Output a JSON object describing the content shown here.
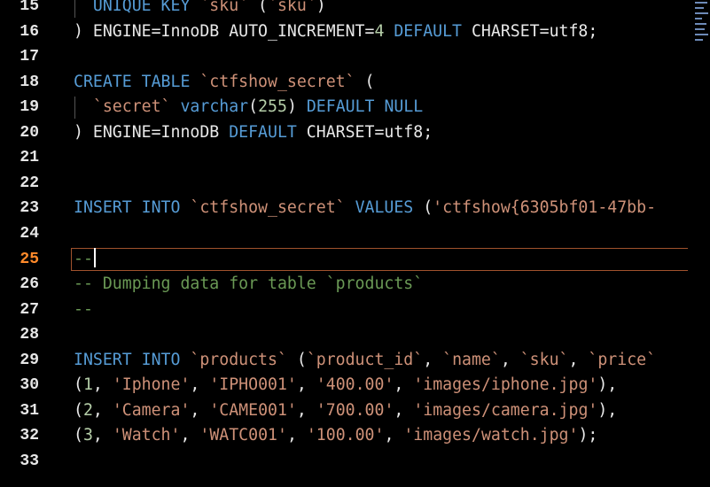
{
  "editor": {
    "active_line": 25,
    "lines": [
      {
        "n": "15",
        "tokens": [
          [
            "pl",
            "  "
          ],
          [
            "kw",
            "UNIQUE KEY"
          ],
          [
            "pl",
            " "
          ],
          [
            "str",
            "`sku`"
          ],
          [
            "pl",
            " ("
          ],
          [
            "str",
            "`sku`"
          ],
          [
            "pl",
            ")"
          ]
        ]
      },
      {
        "n": "16",
        "tokens": [
          [
            "pl",
            ") ENGINE=InnoDB AUTO_INCREMENT="
          ],
          [
            "num",
            "4"
          ],
          [
            "pl",
            " "
          ],
          [
            "kw",
            "DEFAULT"
          ],
          [
            "pl",
            " CHARSET=utf8;"
          ]
        ]
      },
      {
        "n": "17",
        "tokens": []
      },
      {
        "n": "18",
        "tokens": [
          [
            "kw",
            "CREATE TABLE"
          ],
          [
            "pl",
            " "
          ],
          [
            "str",
            "`ctfshow_secret`"
          ],
          [
            "pl",
            " ("
          ]
        ]
      },
      {
        "n": "19",
        "tokens": [
          [
            "pl",
            "  "
          ],
          [
            "str",
            "`secret`"
          ],
          [
            "pl",
            " "
          ],
          [
            "kw",
            "varchar"
          ],
          [
            "pl",
            "("
          ],
          [
            "num",
            "255"
          ],
          [
            "pl",
            ") "
          ],
          [
            "kw",
            "DEFAULT NULL"
          ]
        ]
      },
      {
        "n": "20",
        "tokens": [
          [
            "pl",
            ") ENGINE=InnoDB "
          ],
          [
            "kw",
            "DEFAULT"
          ],
          [
            "pl",
            " CHARSET=utf8;"
          ]
        ]
      },
      {
        "n": "21",
        "tokens": []
      },
      {
        "n": "22",
        "tokens": []
      },
      {
        "n": "23",
        "tokens": [
          [
            "kw",
            "INSERT INTO"
          ],
          [
            "pl",
            " "
          ],
          [
            "str",
            "`ctfshow_secret`"
          ],
          [
            "pl",
            " "
          ],
          [
            "kw",
            "VALUES"
          ],
          [
            "pl",
            " ("
          ],
          [
            "str",
            "'ctfshow{6305bf01-47bb-"
          ]
        ]
      },
      {
        "n": "24",
        "tokens": []
      },
      {
        "n": "25",
        "tokens": [
          [
            "cm",
            "--"
          ]
        ]
      },
      {
        "n": "26",
        "tokens": [
          [
            "cm",
            "-- Dumping data for table `products`"
          ]
        ]
      },
      {
        "n": "27",
        "tokens": [
          [
            "cm",
            "--"
          ]
        ]
      },
      {
        "n": "28",
        "tokens": []
      },
      {
        "n": "29",
        "tokens": [
          [
            "kw",
            "INSERT INTO"
          ],
          [
            "pl",
            " "
          ],
          [
            "str",
            "`products`"
          ],
          [
            "pl",
            " ("
          ],
          [
            "str",
            "`product_id`"
          ],
          [
            "pl",
            ", "
          ],
          [
            "str",
            "`name`"
          ],
          [
            "pl",
            ", "
          ],
          [
            "str",
            "`sku`"
          ],
          [
            "pl",
            ", "
          ],
          [
            "str",
            "`price`"
          ]
        ]
      },
      {
        "n": "30",
        "tokens": [
          [
            "pl",
            "("
          ],
          [
            "num",
            "1"
          ],
          [
            "pl",
            ", "
          ],
          [
            "str",
            "'Iphone'"
          ],
          [
            "pl",
            ", "
          ],
          [
            "str",
            "'IPHO001'"
          ],
          [
            "pl",
            ", "
          ],
          [
            "str",
            "'400.00'"
          ],
          [
            "pl",
            ", "
          ],
          [
            "str",
            "'images/iphone.jpg'"
          ],
          [
            "pl",
            "),"
          ]
        ]
      },
      {
        "n": "31",
        "tokens": [
          [
            "pl",
            "("
          ],
          [
            "num",
            "2"
          ],
          [
            "pl",
            ", "
          ],
          [
            "str",
            "'Camera'"
          ],
          [
            "pl",
            ", "
          ],
          [
            "str",
            "'CAME001'"
          ],
          [
            "pl",
            ", "
          ],
          [
            "str",
            "'700.00'"
          ],
          [
            "pl",
            ", "
          ],
          [
            "str",
            "'images/camera.jpg'"
          ],
          [
            "pl",
            "),"
          ]
        ]
      },
      {
        "n": "32",
        "tokens": [
          [
            "pl",
            "("
          ],
          [
            "num",
            "3"
          ],
          [
            "pl",
            ", "
          ],
          [
            "str",
            "'Watch'"
          ],
          [
            "pl",
            ", "
          ],
          [
            "str",
            "'WATC001'"
          ],
          [
            "pl",
            ", "
          ],
          [
            "str",
            "'100.00'"
          ],
          [
            "pl",
            ", "
          ],
          [
            "str",
            "'images/watch.jpg'"
          ],
          [
            "pl",
            ");"
          ]
        ]
      },
      {
        "n": "33",
        "tokens": []
      }
    ]
  },
  "colors": {
    "background": "#000000",
    "keyword": "#569cd6",
    "string": "#ce9178",
    "number": "#b5cea8",
    "comment": "#6a9955",
    "active_line_number": "#ff8a2a"
  }
}
